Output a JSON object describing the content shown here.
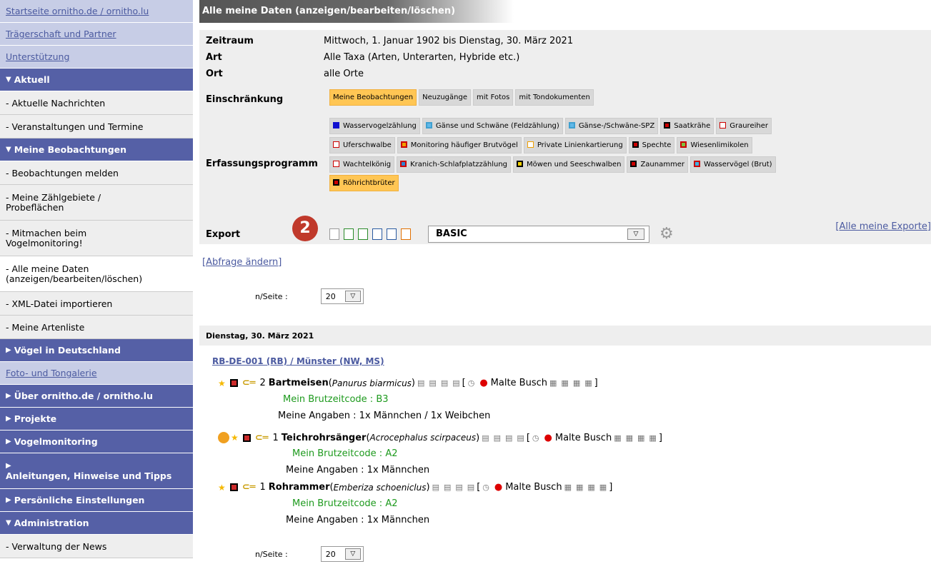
{
  "sidebar": {
    "items": [
      {
        "type": "link",
        "label": "Startseite ornitho.de / ornitho.lu"
      },
      {
        "type": "link",
        "label": "Trägerschaft und Partner"
      },
      {
        "type": "link",
        "label": "Unterstützung"
      },
      {
        "type": "head",
        "label": "Aktuell",
        "marker": "▼"
      },
      {
        "type": "item",
        "label": "- Aktuelle Nachrichten"
      },
      {
        "type": "item",
        "label": "- Veranstaltungen und Termine"
      },
      {
        "type": "head",
        "label": "Meine Beobachtungen",
        "marker": "▼"
      },
      {
        "type": "item",
        "label": "- Beobachtungen melden"
      },
      {
        "type": "item2",
        "label": "- Meine Zählgebiete /\nProbeflächen"
      },
      {
        "type": "item2",
        "label": "- Mitmachen beim\nVogelmonitoring!"
      },
      {
        "type": "active",
        "label": "- Alle meine Daten\n(anzeigen/bearbeiten/löschen)"
      },
      {
        "type": "item",
        "label": "- XML-Datei importieren"
      },
      {
        "type": "item",
        "label": "- Meine Artenliste"
      },
      {
        "type": "head",
        "label": "Vögel in Deutschland",
        "marker": "▶"
      },
      {
        "type": "link",
        "label": "Foto- und Tongalerie"
      },
      {
        "type": "head",
        "label": "Über ornitho.de / ornitho.lu",
        "marker": "▶"
      },
      {
        "type": "head",
        "label": "Projekte",
        "marker": "▶"
      },
      {
        "type": "head",
        "label": "Vogelmonitoring",
        "marker": "▶"
      },
      {
        "type": "headtall",
        "label": "Anleitungen, Hinweise und Tipps",
        "marker": "▶"
      },
      {
        "type": "head",
        "label": "Persönliche Einstellungen",
        "marker": "▶"
      },
      {
        "type": "head",
        "label": "Administration",
        "marker": "▼"
      },
      {
        "type": "item",
        "label": "- Verwaltung der News"
      }
    ]
  },
  "main": {
    "title": "Alle meine Daten (anzeigen/bearbeiten/löschen)",
    "query": {
      "zeitraum_label": "Zeitraum",
      "zeitraum": "Mittwoch, 1. Januar 1902 bis Dienstag, 30. März 2021",
      "art_label": "Art",
      "art": "Alle Taxa (Arten, Unterarten, Hybride etc.)",
      "ort_label": "Ort",
      "ort": "alle Orte",
      "einschraenkung_label": "Einschränkung",
      "einschraenkung_tags": [
        "Meine Beobachtungen",
        "Neuzugänge",
        "mit Fotos",
        "mit Tondokumenten"
      ],
      "programm_label": "Erfassungsprogramm",
      "programm_rows": [
        [
          {
            "label": "Wasservogelzählung",
            "border": "#1010d0",
            "fill": "#1010d0"
          },
          {
            "label": "Gänse und Schwäne (Feldzählung)",
            "border": "#40a0d0",
            "fill": "#60b8e8"
          },
          {
            "label": "Gänse-/Schwäne-SPZ",
            "border": "#40a0d0",
            "fill": "#60b8e8"
          },
          {
            "label": "Saatkrähe",
            "border": "#000",
            "fill": "#c00"
          },
          {
            "label": "Graureiher",
            "border": "#c00",
            "fill": "#fff"
          }
        ],
        [
          {
            "label": "Uferschwalbe",
            "border": "#c00",
            "fill": "#fff"
          },
          {
            "label": "Monitoring häufiger Brutvögel",
            "border": "#c00",
            "fill": "#f0a000"
          },
          {
            "label": "Private Linienkartierung",
            "border": "#f0a000",
            "fill": "#fff"
          },
          {
            "label": "Spechte",
            "border": "#000",
            "fill": "#c00"
          },
          {
            "label": "Wiesenlimikolen",
            "border": "#c00",
            "fill": "#80c040"
          }
        ],
        [
          {
            "label": "Wachtelkönig",
            "border": "#c00",
            "fill": "#fff"
          },
          {
            "label": "Kranich-Schlafplatzzählung",
            "border": "#c00",
            "fill": "#3080d0"
          },
          {
            "label": "Möwen und Seeschwalben",
            "border": "#000",
            "fill": "#f0d000"
          },
          {
            "label": "Zaunammer",
            "border": "#000",
            "fill": "#c00"
          },
          {
            "label": "Wasservögel (Brut)",
            "border": "#c00",
            "fill": "#40b0e0"
          }
        ],
        [
          {
            "label": "Röhrichtbrüter",
            "border": "#000",
            "fill": "#c00",
            "active": true
          }
        ]
      ],
      "export_label": "Export",
      "export_format": "BASIC",
      "all_exports": "[Alle meine Exporte]",
      "badge": "2"
    },
    "abfrage_link": "[Abfrage ändern]",
    "perpage_label": "n/Seite :",
    "perpage_value": "20",
    "day": "Dienstag, 30. März 2021",
    "place": "RB-DE-001 (RB) / Münster (NW, MS)",
    "observations": [
      {
        "count": "2",
        "species": "Bartmeisen",
        "latin": "Panurus biarmicus",
        "observer": "Malte Busch",
        "code": "Mein Brutzeitcode : B3",
        "details": "Meine Angaben : 1x Männchen / 1x Weibchen"
      },
      {
        "count": "1",
        "species": "Teichrohrsänger",
        "latin": "Acrocephalus scirpaceus",
        "observer": "Malte Busch",
        "code": "Mein Brutzeitcode : A2",
        "details": "Meine Angaben : 1x Männchen"
      },
      {
        "count": "1",
        "species": "Rohrammer",
        "latin": "Emberiza schoeniclus",
        "observer": "Malte Busch",
        "code": "Mein Brutzeitcode : A2",
        "details": "Meine Angaben : 1x Männchen"
      }
    ]
  }
}
